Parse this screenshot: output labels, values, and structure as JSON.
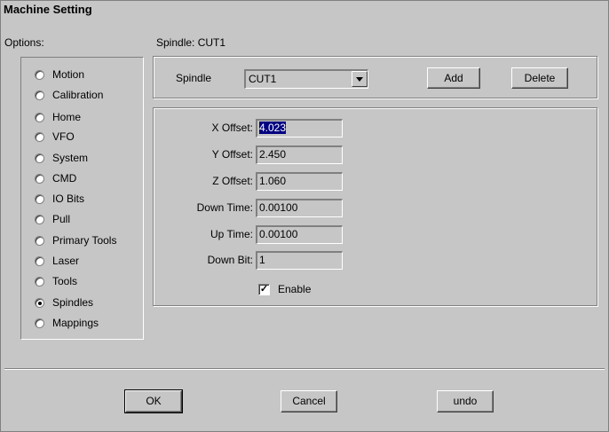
{
  "window": {
    "title": "Machine Setting"
  },
  "options": {
    "label": "Options:",
    "items": [
      {
        "label": "Motion",
        "selected": false
      },
      {
        "label": "Calibration",
        "selected": false
      },
      {
        "label": "Home",
        "selected": false
      },
      {
        "label": "VFO",
        "selected": false
      },
      {
        "label": "System",
        "selected": false
      },
      {
        "label": "CMD",
        "selected": false
      },
      {
        "label": "IO Bits",
        "selected": false
      },
      {
        "label": "Pull",
        "selected": false
      },
      {
        "label": "Primary Tools",
        "selected": false
      },
      {
        "label": "Laser",
        "selected": false
      },
      {
        "label": "Tools",
        "selected": false
      },
      {
        "label": "Spindles",
        "selected": true
      },
      {
        "label": "Mappings",
        "selected": false
      }
    ]
  },
  "panel": {
    "heading": "Spindle:  CUT1",
    "spindle_label": "Spindle",
    "spindle_value": "CUT1",
    "add_label": "Add",
    "delete_label": "Delete",
    "fields": [
      {
        "label": "X Offset:",
        "value": "4.023"
      },
      {
        "label": "Y Offset:",
        "value": "2.450"
      },
      {
        "label": "Z Offset:",
        "value": "1.060"
      },
      {
        "label": "Down Time:",
        "value": "0.00100"
      },
      {
        "label": "Up Time:",
        "value": "0.00100"
      },
      {
        "label": "Down Bit:",
        "value": "1"
      }
    ],
    "enable_label": "Enable",
    "enable_checked": true
  },
  "footer": {
    "ok_label": "OK",
    "cancel_label": "Cancel",
    "undo_label": "undo"
  }
}
